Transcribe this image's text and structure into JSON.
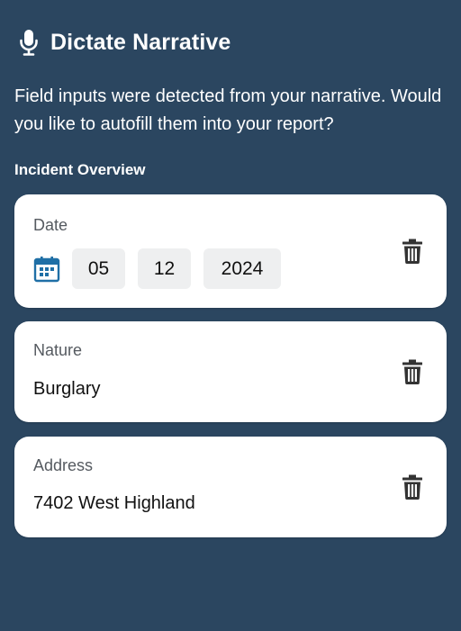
{
  "header": {
    "title": "Dictate Narrative",
    "icon": "microphone-icon"
  },
  "intro": {
    "text": "Field inputs were detected from your narrative. Would you like to autofill them into your report?"
  },
  "section": {
    "title": "Incident Overview"
  },
  "fields": {
    "date": {
      "label": "Date",
      "month": "05",
      "day": "12",
      "year": "2024"
    },
    "nature": {
      "label": "Nature",
      "value": "Burglary"
    },
    "address": {
      "label": "Address",
      "value": "7402 West Highland"
    }
  },
  "colors": {
    "background": "#2b4660",
    "card": "#ffffff",
    "calendar_accent": "#1f6fa6",
    "trash": "#333333"
  }
}
